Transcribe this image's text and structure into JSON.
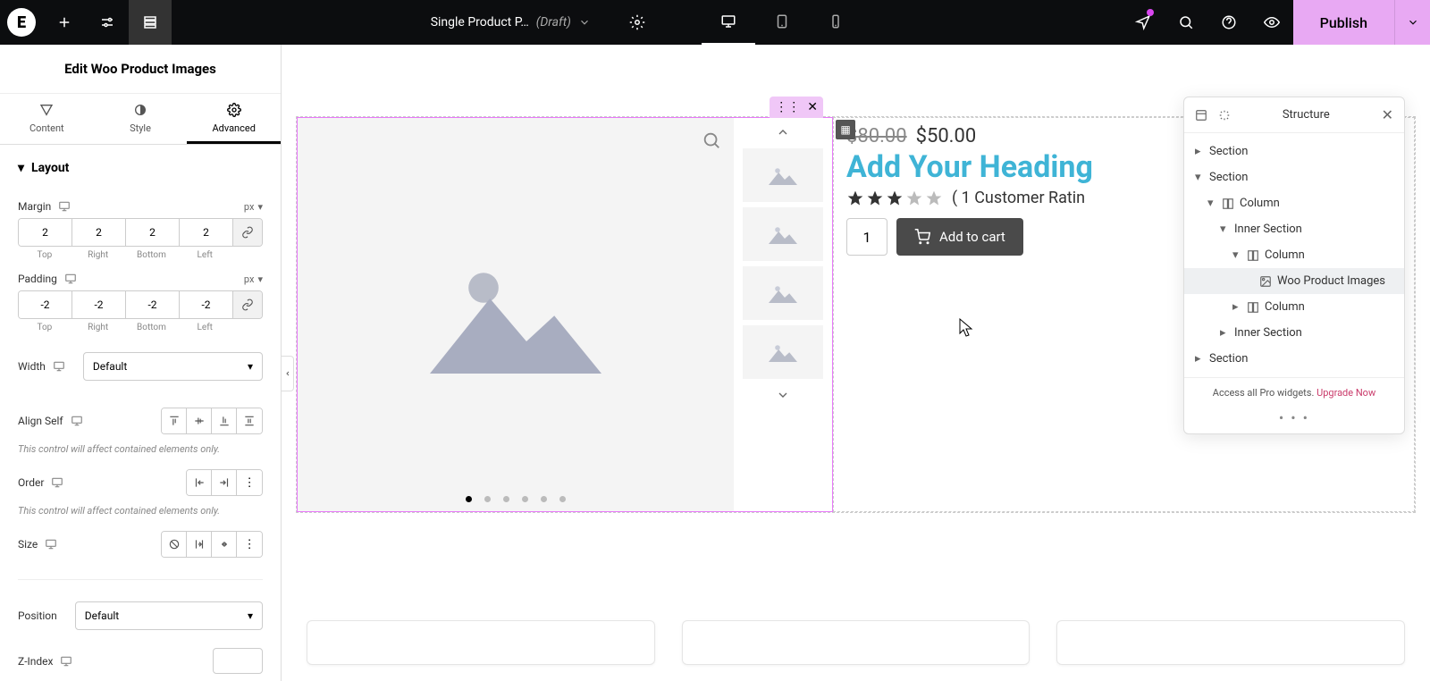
{
  "topbar": {
    "doc_title": "Single Product P…",
    "doc_status": "(Draft)",
    "publish_label": "Publish"
  },
  "panel": {
    "title": "Edit Woo Product Images",
    "tabs": {
      "content": "Content",
      "style": "Style",
      "advanced": "Advanced"
    },
    "layout_label": "Layout",
    "margin_label": "Margin",
    "padding_label": "Padding",
    "unit_px": "px",
    "dim_labels": {
      "top": "Top",
      "right": "Right",
      "bottom": "Bottom",
      "left": "Left"
    },
    "margin": {
      "top": "2",
      "right": "2",
      "bottom": "2",
      "left": "2"
    },
    "padding": {
      "top": "-2",
      "right": "-2",
      "bottom": "-2",
      "left": "-2"
    },
    "width_label": "Width",
    "width_value": "Default",
    "alignself_label": "Align Self",
    "note1": "This control will affect contained elements only.",
    "order_label": "Order",
    "note2": "This control will affect contained elements only.",
    "size_label": "Size",
    "position_label": "Position",
    "position_value": "Default",
    "zindex_label": "Z-Index"
  },
  "product": {
    "old_price": "$80.00",
    "new_price": "$50.00",
    "heading": "Add Your Heading",
    "rating_text": "( 1 Customer Ratin",
    "rating_value": 3,
    "qty": "1",
    "cart_label": "Add to cart"
  },
  "structure": {
    "title": "Structure",
    "items": [
      {
        "label": "Section",
        "indent": 0,
        "icon": "",
        "caret": "▸"
      },
      {
        "label": "Section",
        "indent": 0,
        "icon": "",
        "caret": "▾"
      },
      {
        "label": "Column",
        "indent": 1,
        "icon": "col",
        "caret": "▾"
      },
      {
        "label": "Inner Section",
        "indent": 2,
        "icon": "",
        "caret": "▾"
      },
      {
        "label": "Column",
        "indent": 3,
        "icon": "col",
        "caret": "▾"
      },
      {
        "label": "Woo Product Images",
        "indent": 4,
        "icon": "img",
        "selected": true
      },
      {
        "label": "Column",
        "indent": 3,
        "icon": "col",
        "caret": "▸"
      },
      {
        "label": "Inner Section",
        "indent": 2,
        "icon": "",
        "caret": "▸"
      },
      {
        "label": "Section",
        "indent": 0,
        "icon": "",
        "caret": "▸"
      }
    ],
    "footer_text": "Access all Pro widgets. ",
    "upgrade_label": "Upgrade Now"
  }
}
